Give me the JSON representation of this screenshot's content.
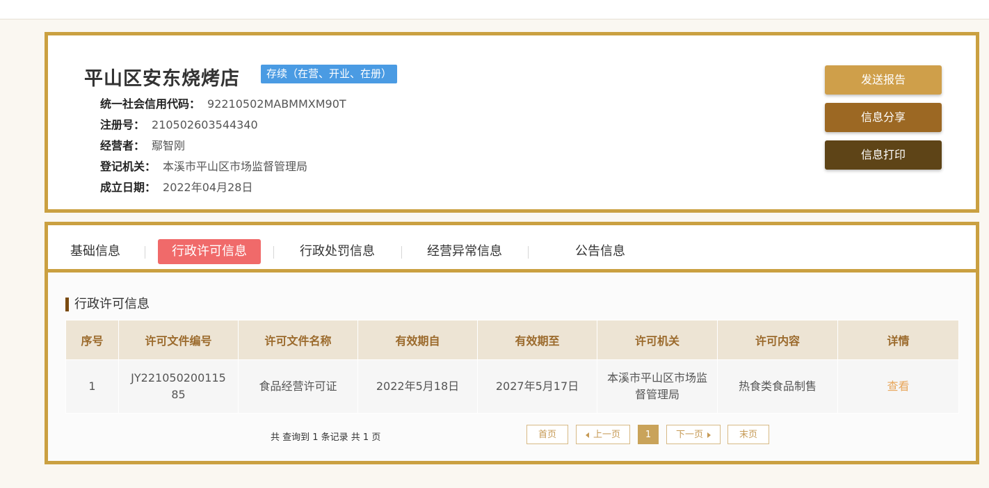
{
  "company": {
    "name": "平山区安东烧烤店",
    "status": "存续（在营、开业、在册）",
    "fields": [
      {
        "label": "统一社会信用代码：",
        "value": "92210502MABMMXM90T"
      },
      {
        "label": "注册号：",
        "value": "210502603544340"
      },
      {
        "label": "经营者：",
        "value": "鄢智刚"
      },
      {
        "label": "登记机关：",
        "value": "本溪市平山区市场监督管理局"
      },
      {
        "label": "成立日期：",
        "value": "2022年04月28日"
      }
    ]
  },
  "actions": {
    "send_report": "发送报告",
    "share": "信息分享",
    "print": "信息打印"
  },
  "tabs": [
    {
      "label": "基础信息",
      "active": false
    },
    {
      "label": "行政许可信息",
      "active": true
    },
    {
      "label": "行政处罚信息",
      "active": false
    },
    {
      "label": "经营异常信息",
      "active": false
    },
    {
      "label": "公告信息",
      "active": false
    }
  ],
  "section": {
    "title": "行政许可信息"
  },
  "table": {
    "headers": [
      "序号",
      "许可文件编号",
      "许可文件名称",
      "有效期自",
      "有效期至",
      "许可机关",
      "许可内容",
      "详情"
    ],
    "rows": [
      [
        "1",
        "JY22105020011585",
        "食品经营许可证",
        "2022年5月18日",
        "2027年5月17日",
        "本溪市平山区市场监督管理局",
        "热食类食品制售",
        "查看"
      ]
    ]
  },
  "pagination": {
    "summary": "共 查询到 1 条记录 共 1 页",
    "first": "首页",
    "prev": "上一页",
    "current": "1",
    "next": "下一页",
    "last": "末页"
  },
  "colors": {
    "frame": "#caa041",
    "badge": "#4a9be3",
    "active_tab": "#f06a6a",
    "report_button": "#cf9f4a",
    "share_button": "#9c6823",
    "print_button": "#5e4417"
  }
}
